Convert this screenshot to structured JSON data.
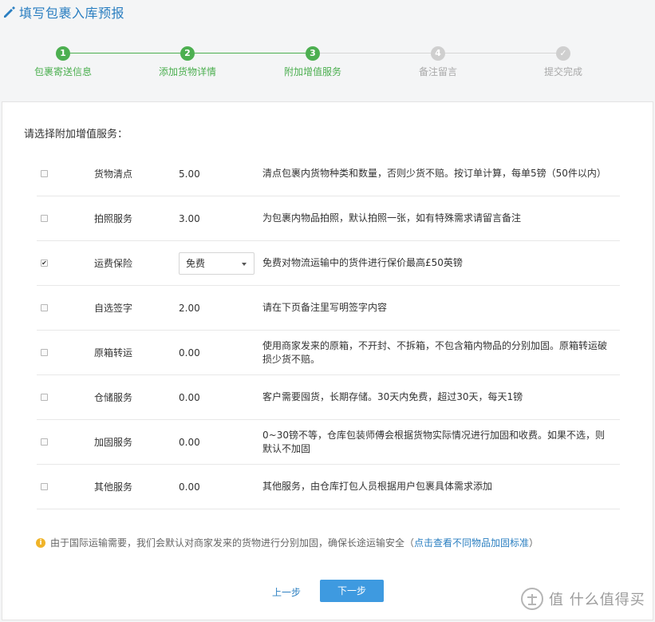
{
  "header": {
    "title": "填写包裹入库预报"
  },
  "steps": [
    {
      "number": "1",
      "label": "包裹寄送信息",
      "state": "done"
    },
    {
      "number": "2",
      "label": "添加货物详情",
      "state": "done"
    },
    {
      "number": "3",
      "label": "附加增值服务",
      "state": "done"
    },
    {
      "number": "4",
      "label": "备注留言",
      "state": "todo"
    },
    {
      "number": "✓",
      "label": "提交完成",
      "state": "todo"
    }
  ],
  "prompt": "请选择附加增值服务：",
  "services": [
    {
      "checked": false,
      "name": "货物清点",
      "price": "5.00",
      "desc": "清点包裹内货物种类和数量，否则少货不赔。按订单计算，每单5镑（50件以内）"
    },
    {
      "checked": false,
      "name": "拍照服务",
      "price": "3.00",
      "desc": "为包裹内物品拍照，默认拍照一张，如有特殊需求请留言备注"
    },
    {
      "checked": true,
      "name": "运费保险",
      "select_value": "免费",
      "desc": "免费对物流运输中的货件进行保价最高£50英镑"
    },
    {
      "checked": false,
      "name": "自选签字",
      "price": "2.00",
      "desc": "请在下页备注里写明签字内容"
    },
    {
      "checked": false,
      "name": "原箱转运",
      "price": "0.00",
      "desc": "使用商家发来的原箱，不开封、不拆箱，不包含箱内物品的分别加固。原箱转运破损少货不赔。"
    },
    {
      "checked": false,
      "name": "仓储服务",
      "price": "0.00",
      "desc": "客户需要囤货，长期存储。30天内免费，超过30天，每天1镑"
    },
    {
      "checked": false,
      "name": "加固服务",
      "price": "0.00",
      "desc": "0~30镑不等，仓库包装师傅会根据货物实际情况进行加固和收费。如果不选，则默认不加固"
    },
    {
      "checked": false,
      "name": "其他服务",
      "price": "0.00",
      "desc": "其他服务，由仓库打包人员根据用户包裹具体需求添加"
    }
  ],
  "note": {
    "text": "由于国际运输需要，我们会默认对商家发来的货物进行分别加固，确保长途运输安全（",
    "link": "点击查看不同物品加固标准",
    "tail": "）"
  },
  "buttons": {
    "prev": "上一步",
    "next": "下一步"
  },
  "watermark": {
    "text": "值 什么值得买"
  },
  "colors": {
    "accent": "#2b7fc1",
    "done": "#4caf50",
    "todo": "#cfcfcf",
    "primary_button": "#3e9ae0",
    "info": "#f0b429"
  }
}
